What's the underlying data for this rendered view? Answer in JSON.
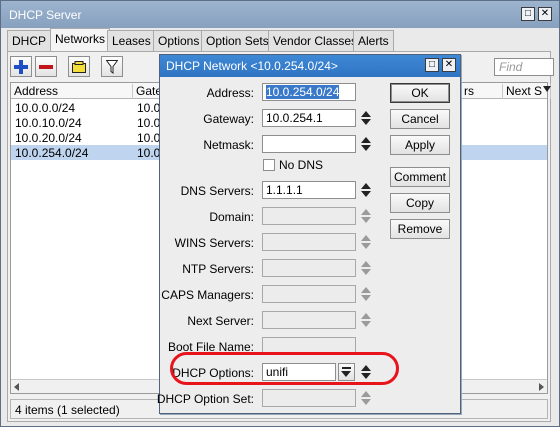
{
  "window": {
    "title": "DHCP Server"
  },
  "tabs": [
    "DHCP",
    "Networks",
    "Leases",
    "Options",
    "Option Sets",
    "Vendor Classes",
    "Alerts"
  ],
  "toolbar": {
    "find_placeholder": "Find"
  },
  "table": {
    "columns": [
      "Address",
      "Gatew",
      "rs",
      "Next S"
    ],
    "rows": [
      {
        "address": "10.0.0.0/24",
        "gateway": "10.0.",
        "selected": false
      },
      {
        "address": "10.0.10.0/24",
        "gateway": "10.0.",
        "selected": false
      },
      {
        "address": "10.0.20.0/24",
        "gateway": "10.0.",
        "selected": false
      },
      {
        "address": "10.0.254.0/24",
        "gateway": "10.0.2",
        "selected": true
      }
    ]
  },
  "status": "4 items (1 selected)",
  "dialog": {
    "title": "DHCP Network <10.0.254.0/24>",
    "fields": {
      "address": {
        "label": "Address:",
        "value": "10.0.254.0/24"
      },
      "gateway": {
        "label": "Gateway:",
        "value": "10.0.254.1"
      },
      "netmask": {
        "label": "Netmask:",
        "value": ""
      },
      "no_dns": {
        "label": "No DNS"
      },
      "dns_servers": {
        "label": "DNS Servers:",
        "value": "1.1.1.1"
      },
      "domain": {
        "label": "Domain:",
        "value": ""
      },
      "wins_servers": {
        "label": "WINS Servers:",
        "value": ""
      },
      "ntp_servers": {
        "label": "NTP Servers:",
        "value": ""
      },
      "caps_managers": {
        "label": "CAPS Managers:",
        "value": ""
      },
      "next_server": {
        "label": "Next Server:",
        "value": ""
      },
      "boot_file_name": {
        "label": "Boot File Name:",
        "value": ""
      },
      "dhcp_options": {
        "label": "DHCP Options:",
        "value": "unifi"
      },
      "dhcp_option_set": {
        "label": "DHCP Option Set:",
        "value": ""
      }
    },
    "buttons": {
      "ok": "OK",
      "cancel": "Cancel",
      "apply": "Apply",
      "comment": "Comment",
      "copy": "Copy",
      "remove": "Remove"
    }
  },
  "colors": {
    "highlight": "#e8141c",
    "selection": "#bfd4ef",
    "dialog_title": "#2f74c2"
  }
}
